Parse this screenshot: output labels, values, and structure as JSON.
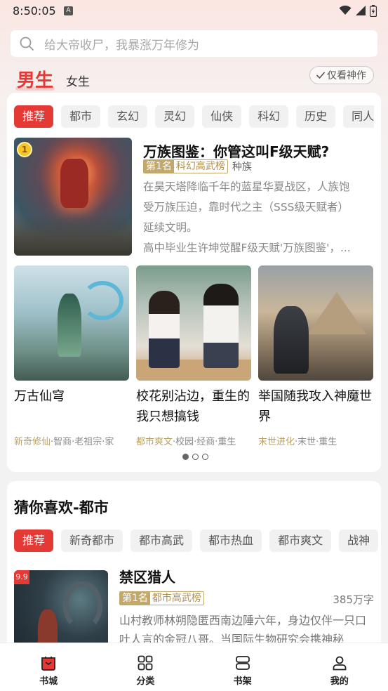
{
  "status": {
    "time": "8:50:05",
    "notification_icon": "A"
  },
  "search": {
    "placeholder": "给大帝收尸，我暴涨万年修为"
  },
  "gender_tabs": {
    "male": "男生",
    "female": "女生"
  },
  "filter_toggle": {
    "label": "仅看神作"
  },
  "categories": [
    "推荐",
    "都市",
    "玄幻",
    "灵幻",
    "仙侠",
    "科幻",
    "历史",
    "同人"
  ],
  "featured": {
    "rank_medal": "1",
    "title": "万族图鉴：你管这叫F级天赋?",
    "rank_label": "第1名",
    "rank_list": "科幻高武榜",
    "genre": "种族",
    "description_lines": [
      "在昊天塔降临千年的蓝星华夏战区，人族饱",
      "受万族压迫，靠时代之主（SSS级天赋者）",
      "延续文明。",
      "高中毕业生许坤觉醒F级天赋'万族图鉴'，..."
    ]
  },
  "grid_books": [
    {
      "title": "万古仙穹",
      "tag_highlight": "新奇修仙",
      "tags": "·智商·老祖宗·家"
    },
    {
      "title": "校花别沾边，重生的我只想搞钱",
      "tag_highlight": "都市爽文",
      "tags": "·校园·经商·重生"
    },
    {
      "title": "举国随我攻入神魔世界",
      "tag_highlight": "末世进化",
      "tags": "·末世·重生"
    }
  ],
  "carousel": {
    "pages": 3,
    "active": 1
  },
  "guess": {
    "title": "猜你喜欢-都市",
    "chips": [
      "推荐",
      "新奇都市",
      "都市高武",
      "都市热血",
      "都市爽文",
      "战神"
    ],
    "book": {
      "score": "9.9",
      "title": "禁区猎人",
      "rank_label": "第1名",
      "rank_list": "都市高武榜",
      "word_count": "385万字",
      "description": "山村教师林朔隐匿西南边陲六年，身边仅伴一只口吐人言的金冠八哥。当国际生物研究会携神秘"
    }
  },
  "bottom_nav": [
    {
      "label": "书城",
      "icon": "bookstore-icon",
      "active": true
    },
    {
      "label": "分类",
      "icon": "category-grid-icon",
      "active": false
    },
    {
      "label": "书架",
      "icon": "bookshelf-icon",
      "active": false
    },
    {
      "label": "我的",
      "icon": "profile-icon",
      "active": false
    }
  ],
  "colors": {
    "accent": "#e53935",
    "gold": "#c2a86b"
  }
}
